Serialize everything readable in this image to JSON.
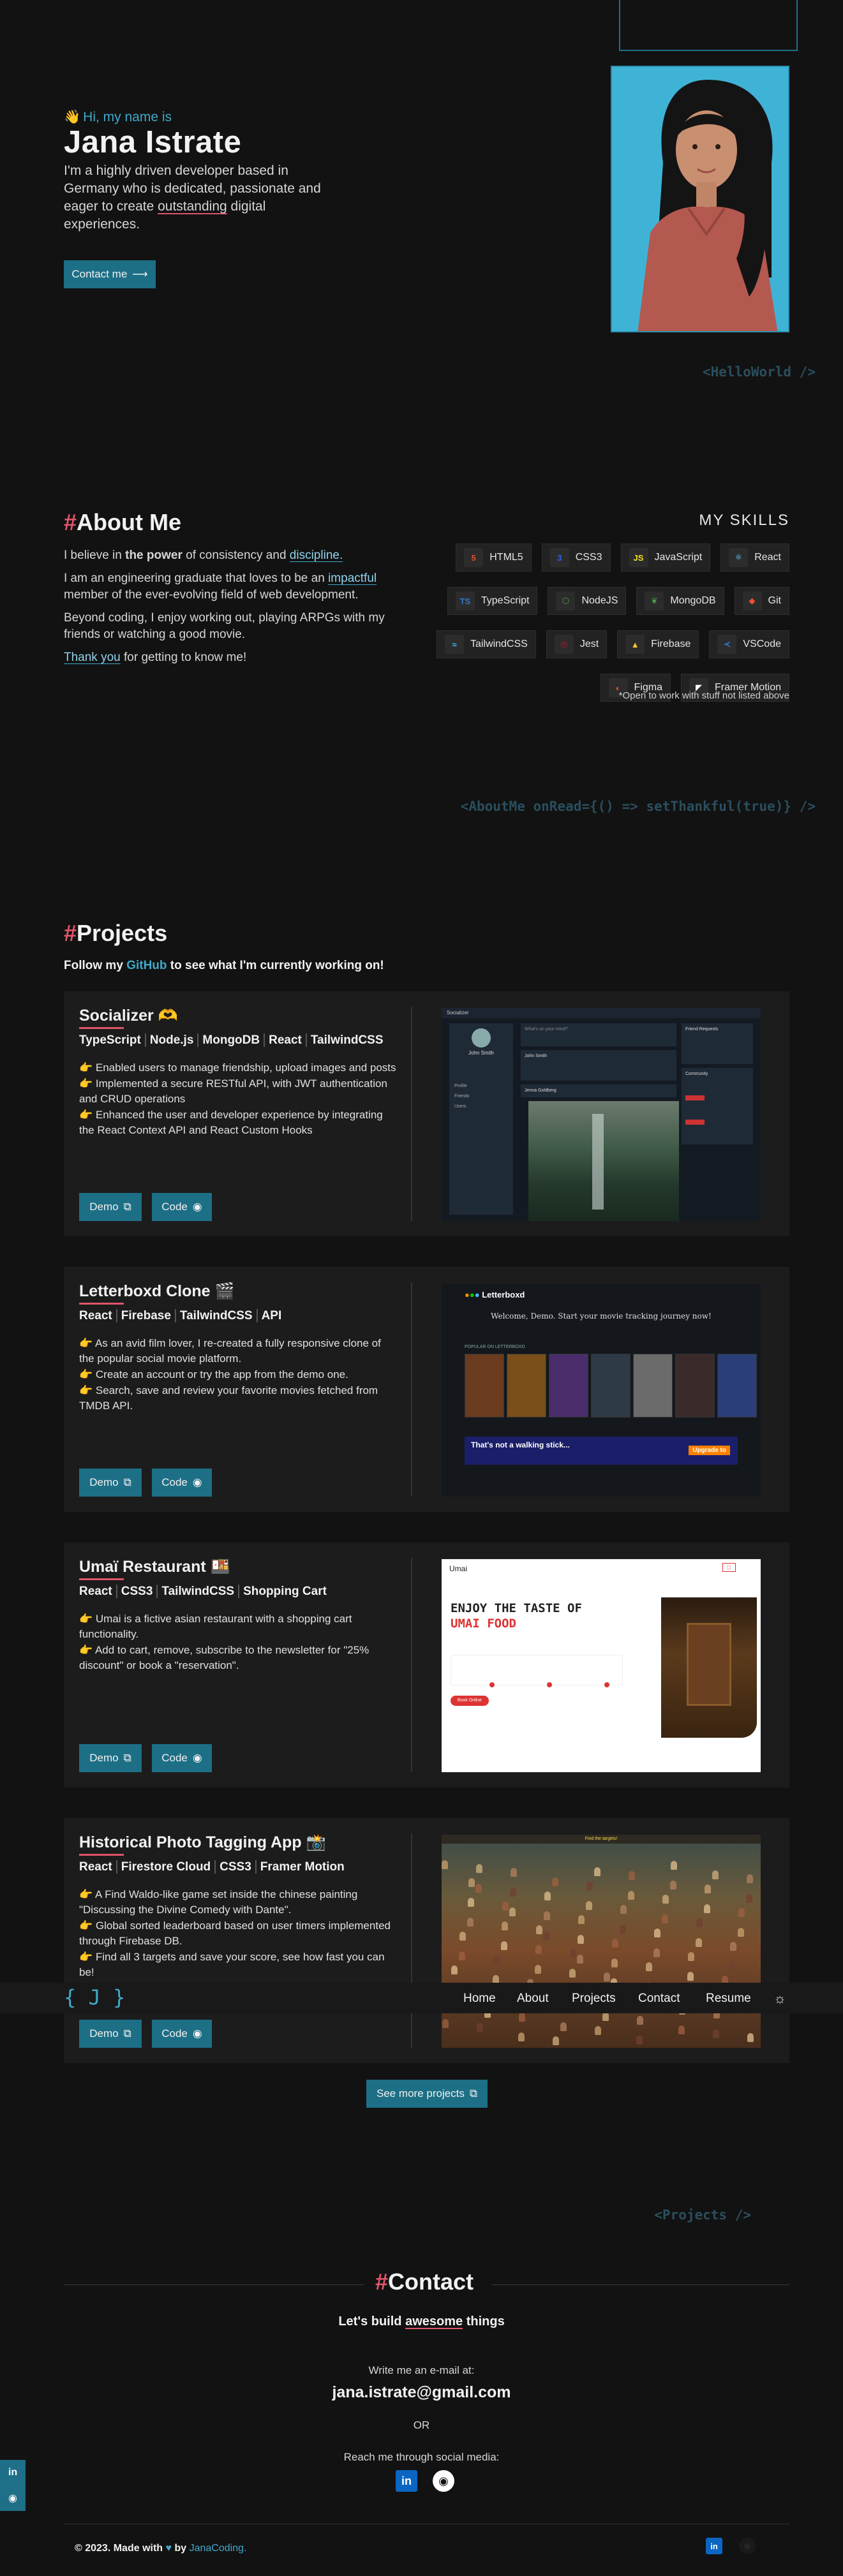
{
  "hero": {
    "greeting": "Hi, my name is",
    "name": "Jana Istrate",
    "description_parts": [
      "I'm a highly driven developer based in Germany who is dedicated, passionate and eager to create ",
      "outstanding",
      " digital experiences."
    ],
    "contact_button": "Contact me",
    "code_tag": "<HelloWorld />"
  },
  "about": {
    "title_hash": "#",
    "title": "About Me",
    "p1_parts": [
      "I believe in ",
      "the power",
      " of consistency and ",
      "discipline."
    ],
    "p2_parts": [
      "I am an engineering graduate that loves to be an ",
      "impactful",
      " member of the ever-evolving field of web development."
    ],
    "p3": "Beyond coding, I enjoy working out, playing ARPGs with my friends or watching a good movie.",
    "p4_parts": [
      "Thank you",
      " for getting to know me!"
    ],
    "skills_title": "MY SKILLS",
    "skills": [
      {
        "label": "HTML5",
        "icon": "html5-icon",
        "glyph": "5",
        "color": "#e34f26"
      },
      {
        "label": "CSS3",
        "icon": "css3-icon",
        "glyph": "3",
        "color": "#2965f1"
      },
      {
        "label": "JavaScript",
        "icon": "javascript-icon",
        "glyph": "JS",
        "color": "#f7df1e"
      },
      {
        "label": "React",
        "icon": "react-icon",
        "glyph": "⚛",
        "color": "#61dafb"
      },
      {
        "label": "TypeScript",
        "icon": "typescript-icon",
        "glyph": "TS",
        "color": "#3178c6"
      },
      {
        "label": "NodeJS",
        "icon": "nodejs-icon",
        "glyph": "⬡",
        "color": "#539e43"
      },
      {
        "label": "MongoDB",
        "icon": "mongodb-icon",
        "glyph": "❦",
        "color": "#47a248"
      },
      {
        "label": "Git",
        "icon": "git-icon",
        "glyph": "◆",
        "color": "#f05032"
      },
      {
        "label": "TailwindCSS",
        "icon": "tailwindcss-icon",
        "glyph": "≈",
        "color": "#38bdf8"
      },
      {
        "label": "Jest",
        "icon": "jest-icon",
        "glyph": "◎",
        "color": "#c21325"
      },
      {
        "label": "Firebase",
        "icon": "firebase-icon",
        "glyph": "▲",
        "color": "#ffca28"
      },
      {
        "label": "VSCode",
        "icon": "vscode-icon",
        "glyph": "≺",
        "color": "#2f80ed"
      },
      {
        "label": "Figma",
        "icon": "figma-icon",
        "glyph": "◐",
        "color": "#f24e1e"
      },
      {
        "label": "Framer Motion",
        "icon": "framer-motion-icon",
        "glyph": "◤",
        "color": "#ffffff"
      }
    ],
    "skills_note": "*Open to work with stuff not listed above",
    "code_tag": "<AboutMe onRead={() => setThankful(true)} />"
  },
  "projects": {
    "title_hash": "#",
    "title": "Projects",
    "subtitle_parts": [
      "Follow my ",
      "GitHub",
      " to see what I'm currently working on!"
    ],
    "demo_label": "Demo",
    "code_label": "Code",
    "items": [
      {
        "title": "Socializer",
        "emoji": "🫶",
        "tags": [
          "TypeScript",
          "Node.js",
          "MongoDB",
          "React",
          "TailwindCSS"
        ],
        "bullets": [
          "Enabled users to manage friendship, upload images and posts",
          "Implemented a secure RESTful API, with JWT authentication and CRUD operations",
          "Enhanced the user and developer experience by integrating the React Context API and React Custom Hooks"
        ]
      },
      {
        "title": "Letterboxd Clone",
        "emoji": "🎬",
        "tags": [
          "React",
          "Firebase",
          "TailwindCSS",
          "API"
        ],
        "bullets": [
          "As an avid film lover, I re-created a fully responsive clone of the popular social movie platform.",
          "Create an account or try the app from the demo one.",
          "Search, save and review your favorite movies fetched from TMDB API."
        ]
      },
      {
        "title": "Umaï Restaurant",
        "emoji": "🍱",
        "tags": [
          "React",
          "CSS3",
          "TailwindCSS",
          "Shopping Cart"
        ],
        "bullets": [
          "Umai is a fictive asian restaurant with a shopping cart functionality.",
          "Add to cart, remove, subscribe to the newsletter for \"25% discount\" or book a \"reservation\"."
        ]
      },
      {
        "title": "Historical Photo Tagging App",
        "emoji": "📸",
        "tags": [
          "React",
          "Firestore Cloud",
          "CSS3",
          "Framer Motion"
        ],
        "bullets": [
          "A Find Waldo-like game set inside the chinese painting \"Discussing the Divine Comedy with Dante\".",
          "Global sorted leaderboard based on user timers implemented through Firebase DB.",
          "Find all 3 targets and save your score, see how fast you can be!"
        ]
      }
    ],
    "see_more": "See more projects",
    "code_tag": "<Projects />"
  },
  "shots": {
    "socializer": {
      "brand": "Socializer",
      "nav_profile": "Profile",
      "nav_friends": "Friends",
      "nav_users": "Users",
      "user": "John Smith",
      "post_placeholder": "What's on your mind?",
      "post_author": "John Smith",
      "post_author2": "Jenna Goldberg",
      "friend_requests": "Friend Requests",
      "community": "Community"
    },
    "letterboxd": {
      "brand": "Letterboxd",
      "welcome": "Welcome, Demo. Start your movie tracking journey now!",
      "popular": "POPULAR ON LETTERBOXD",
      "banner": "That's not a walking stick...",
      "upgrade": "Upgrade to"
    },
    "umai": {
      "brand": "Umai",
      "headline1": "ENJOY THE TASTE OF",
      "headline2": "UMAI FOOD",
      "cta": "Book Online"
    },
    "waldo": {
      "header": "Find the targets!"
    }
  },
  "navbar": {
    "logo": "{ J }",
    "items": [
      "Home",
      "About",
      "Projects",
      "Contact",
      "Resume"
    ],
    "theme_icon": "sun-icon"
  },
  "contact": {
    "title_hash": "#",
    "title": "Contact",
    "subtitle_parts": [
      "Let's build ",
      "awesome",
      " things"
    ],
    "email_label": "Write me an e-mail at:",
    "email": "jana.istrate@gmail.com",
    "or": "OR",
    "social_label": "Reach me through social media:",
    "social": [
      "linkedin-icon",
      "github-icon"
    ]
  },
  "footer": {
    "text": "© 2023. Made with",
    "by": "by",
    "author": "JanaCoding."
  },
  "colors": {
    "accent_teal": "#1d6f86",
    "accent_red": "#e0556a",
    "background": "#121212",
    "card": "#1c1c1c"
  }
}
